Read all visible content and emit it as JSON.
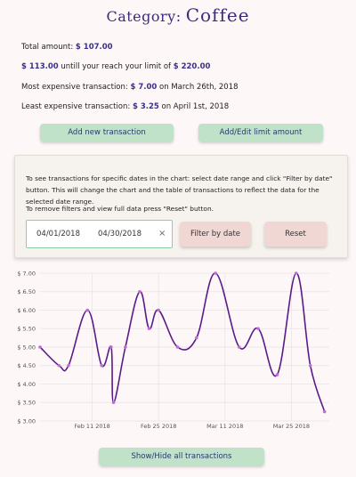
{
  "header": {
    "label": "Category:",
    "category": "Coffee"
  },
  "summary": {
    "total_label": "Total amount:",
    "total_value": "$ 107.00",
    "remaining_value": "$ 113.00",
    "remaining_text": "untill your reach your limit of",
    "limit_value": "$ 220.00",
    "most_label": "Most expensive transaction:",
    "most_value": "$ 7.00",
    "most_on": "on March 26th, 2018",
    "least_label": "Least expensive transaction:",
    "least_value": "$ 3.25",
    "least_on": "on April 1st, 2018"
  },
  "buttons": {
    "add": "Add new transaction",
    "limit": "Add/Edit limit amount",
    "filter": "Filter by date",
    "reset": "Reset",
    "toggle": "Show/Hide all transactions"
  },
  "filter": {
    "help1": "To see transactions for specific dates in the chart: select date range and click \"Filter by date\" button. This will change the chart and the table of transactions to reflect the data for the selected date range.",
    "help2": "To remove filters and view full data press \"Reset\" button.",
    "start": "04/01/2018",
    "end": "04/30/2018",
    "clear": "×"
  },
  "colors": {
    "line": "#5a1a8a",
    "point": "#c26bd8",
    "grid": "#e4e4e4",
    "accent": "#3a2f8a"
  },
  "chart_data": {
    "type": "line",
    "ylim": [
      3.0,
      7.0
    ],
    "y_ticks": [
      "$ 3.00",
      "$ 3.50",
      "$ 4.00",
      "$ 4.50",
      "$ 5.00",
      "$ 5.50",
      "$ 6.00",
      "$ 6.50",
      "$ 7.00"
    ],
    "x_ticks": [
      {
        "label": "Feb 11 2018",
        "day": 11
      },
      {
        "label": "Feb 25 2018",
        "day": 25
      },
      {
        "label": "Mar 11 2018",
        "day": 39
      },
      {
        "label": "Mar 25 2018",
        "day": 53
      }
    ],
    "xlim": [
      0,
      61
    ],
    "points": [
      {
        "day": 0,
        "value": 5.0
      },
      {
        "day": 4,
        "value": 4.5
      },
      {
        "day": 6,
        "value": 4.5
      },
      {
        "day": 10,
        "value": 6.0
      },
      {
        "day": 13,
        "value": 4.5
      },
      {
        "day": 15,
        "value": 5.0
      },
      {
        "day": 15.5,
        "value": 3.5
      },
      {
        "day": 18,
        "value": 5.0
      },
      {
        "day": 21,
        "value": 6.5
      },
      {
        "day": 23,
        "value": 5.5
      },
      {
        "day": 25,
        "value": 6.0
      },
      {
        "day": 29,
        "value": 5.0
      },
      {
        "day": 33,
        "value": 5.25
      },
      {
        "day": 37,
        "value": 7.0
      },
      {
        "day": 42,
        "value": 5.0
      },
      {
        "day": 46,
        "value": 5.5
      },
      {
        "day": 50,
        "value": 4.25
      },
      {
        "day": 54,
        "value": 7.0
      },
      {
        "day": 57,
        "value": 4.5
      },
      {
        "day": 60,
        "value": 3.25
      }
    ]
  }
}
